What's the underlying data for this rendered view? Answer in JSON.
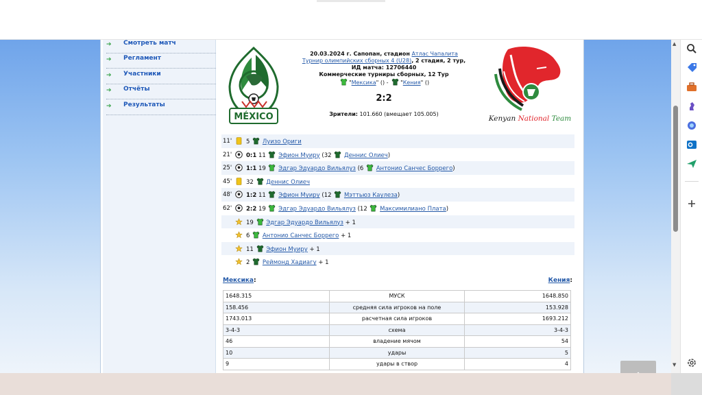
{
  "nav": {
    "items": [
      {
        "label": "Смотреть матч"
      },
      {
        "label": "Регламент"
      },
      {
        "label": "Участники"
      },
      {
        "label": "Отчёты"
      },
      {
        "label": "Результаты"
      }
    ]
  },
  "match": {
    "date_line_pre": "20.03.2024 г. Сапопан, стадион",
    "stadium": "Атлас Чапалита",
    "tournament": "Турнир олимпийских сборных 4 (U28)",
    "tournament_suffix": ", 2 стадия, 2 тур,",
    "match_id": "ИД матча: 12706440",
    "commercial": "Коммерческие турниры сборных, 12 Тур",
    "home": "Мексика",
    "away": "Кения",
    "score": "2:2",
    "spectators_label": "Зрители:",
    "spectators_value": "101.660 (вмещает 105.005)",
    "mexico_logo_text": "MÉXICO",
    "kenya_logo_text_1": "Kenyan ",
    "kenya_logo_text_2": "National",
    "kenya_logo_text_3": " Team"
  },
  "events": [
    {
      "minute": "11'",
      "type": "yellow",
      "pre": "5",
      "shirt": "dark",
      "player": "Луизо Ориги",
      "post": ""
    },
    {
      "minute": "21'",
      "type": "goal",
      "score": "0:1",
      "pre": "11",
      "shirt": "dark",
      "player": "Эфион Муиру",
      "assist_pre": "(32",
      "assist_shirt": "dark",
      "assist": "Деннис Олиеч",
      "assist_post": ")"
    },
    {
      "minute": "25'",
      "type": "goal",
      "score": "1:1",
      "pre": "19",
      "shirt": "green",
      "player": "Эдгар Эдуардо Вильялуз",
      "assist_pre": "(6",
      "assist_shirt": "green",
      "assist": "Антонио Санчес Боррего",
      "assist_post": ")"
    },
    {
      "minute": "45'",
      "type": "yellow",
      "pre": "32",
      "shirt": "dark",
      "player": "Деннис Олиеч",
      "post": ""
    },
    {
      "minute": "48'",
      "type": "goal",
      "score": "1:2",
      "pre": "11",
      "shirt": "dark",
      "player": "Эфион Муиру",
      "assist_pre": "(12",
      "assist_shirt": "dark",
      "assist": "Мэттьюз Каулеза",
      "assist_post": ")"
    },
    {
      "minute": "62'",
      "type": "goal",
      "score": "2:2",
      "pre": "19",
      "shirt": "green",
      "player": "Эдгар Эдуардо Вильялуз",
      "assist_pre": "(12",
      "assist_shirt": "green",
      "assist": "Максимилиано Плата",
      "assist_post": ")"
    },
    {
      "minute": "",
      "type": "star",
      "pre": "19",
      "shirt": "green",
      "player": "Эдгар Эдуардо Вильялуз",
      "post": "+ 1"
    },
    {
      "minute": "",
      "type": "star",
      "pre": "6",
      "shirt": "green",
      "player": "Антонио Санчес Боррего",
      "post": "+ 1"
    },
    {
      "minute": "",
      "type": "star",
      "pre": "11",
      "shirt": "dark",
      "player": "Эфион Муиру",
      "post": "+ 1"
    },
    {
      "minute": "",
      "type": "star",
      "pre": "2",
      "shirt": "dark",
      "player": "Реймонд Хадиагу",
      "post": "+ 1"
    }
  ],
  "stats": {
    "home_label": "Мексика",
    "away_label": "Кения",
    "colon": ":",
    "rows": [
      {
        "home": "1648.315",
        "name": "МУСК",
        "away": "1648.850"
      },
      {
        "home": "158.456",
        "name": "средняя сила игроков на поле",
        "away": "153.928"
      },
      {
        "home": "1743.013",
        "name": "расчетная сила игроков",
        "away": "1693.212"
      },
      {
        "home": "3-4-3",
        "name": "схема",
        "away": "3-4-3"
      },
      {
        "home": "46",
        "name": "владение мячом",
        "away": "54"
      },
      {
        "home": "10",
        "name": "удары",
        "away": "5"
      },
      {
        "home": "9",
        "name": "удары в створ",
        "away": "4"
      }
    ]
  },
  "colors": {
    "link": "#2459a8",
    "nav_link": "#1e58b8",
    "shirt_green": "#3cba3c",
    "shirt_dark": "#1f6b2e",
    "yellow_card": "#f0c419"
  },
  "icons": {
    "scroll_top": "chevron-up-icon",
    "side": [
      "search-icon",
      "tag-icon",
      "briefcase-icon",
      "chess-icon",
      "copilot-icon",
      "outlook-icon",
      "send-icon",
      "plus-icon",
      "settings-icon"
    ]
  }
}
